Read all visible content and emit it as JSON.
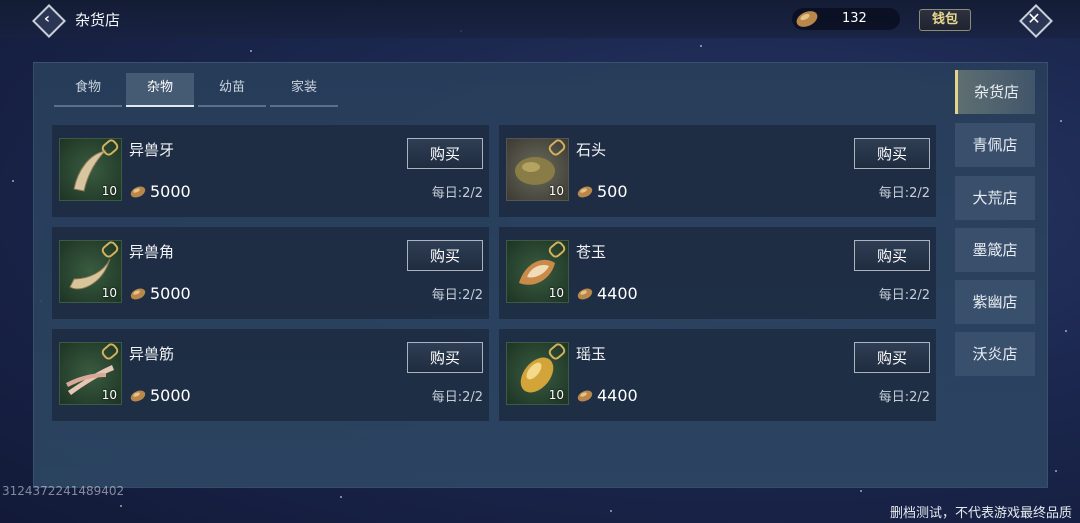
{
  "header": {
    "title": "杂货店",
    "currency_amount": "132",
    "wallet_label": "钱包",
    "back_icon": "back-arrow-icon",
    "close_icon": "close-icon"
  },
  "tabs": [
    {
      "label": "食物",
      "active": false
    },
    {
      "label": "杂物",
      "active": true
    },
    {
      "label": "幼苗",
      "active": false
    },
    {
      "label": "家装",
      "active": false
    }
  ],
  "items": [
    {
      "name": "异兽牙",
      "qty": "10",
      "price": "5000",
      "buy": "购买",
      "daily": "每日:2/2",
      "icon": "beast-tooth-icon"
    },
    {
      "name": "石头",
      "qty": "10",
      "price": "500",
      "buy": "购买",
      "daily": "每日:2/2",
      "icon": "stone-icon"
    },
    {
      "name": "异兽角",
      "qty": "10",
      "price": "5000",
      "buy": "购买",
      "daily": "每日:2/2",
      "icon": "beast-horn-icon"
    },
    {
      "name": "苍玉",
      "qty": "10",
      "price": "4400",
      "buy": "购买",
      "daily": "每日:2/2",
      "icon": "cang-jade-icon"
    },
    {
      "name": "异兽筋",
      "qty": "10",
      "price": "5000",
      "buy": "购买",
      "daily": "每日:2/2",
      "icon": "beast-tendon-icon"
    },
    {
      "name": "瑶玉",
      "qty": "10",
      "price": "4400",
      "buy": "购买",
      "daily": "每日:2/2",
      "icon": "yao-jade-icon"
    }
  ],
  "shops": [
    {
      "label": "杂货店",
      "active": true
    },
    {
      "label": "青佩店",
      "active": false
    },
    {
      "label": "大荒店",
      "active": false
    },
    {
      "label": "墨箴店",
      "active": false
    },
    {
      "label": "紫幽店",
      "active": false
    },
    {
      "label": "沃炎店",
      "active": false
    }
  ],
  "footer": {
    "uid": "3124372241489402",
    "disclaimer": "删档测试，不代表游戏最终品质"
  },
  "colors": {
    "accent_gold": "#e3d48a",
    "panel_bg": "#2e4864",
    "card_bg": "#1c2a40"
  }
}
